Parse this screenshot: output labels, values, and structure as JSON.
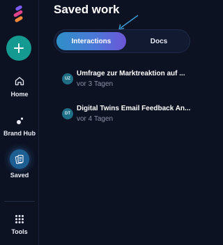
{
  "sidebar": {
    "logo_icon": "app-logo-icon",
    "new_button_icon": "plus-icon",
    "items": [
      {
        "label": "Home",
        "icon": "home-icon"
      },
      {
        "label": "Brand Hub",
        "icon": "brand-hub-icon"
      },
      {
        "label": "Saved",
        "icon": "saved-icon",
        "active": true
      },
      {
        "label": "Tools",
        "icon": "grid-icon"
      }
    ]
  },
  "main": {
    "title": "Saved work",
    "tabs": [
      {
        "label": "Interactions",
        "active": true
      },
      {
        "label": "Docs",
        "active": false
      }
    ],
    "items": [
      {
        "initials": "UZ",
        "title": "Umfrage zur Marktreaktion auf ...",
        "time": "vor 3 Tagen"
      },
      {
        "initials": "DT",
        "title": "Digital Twins Email Feedback An...",
        "time": "vor 4 Tagen"
      }
    ]
  },
  "colors": {
    "background": "#0d1223",
    "accent_teal": "#159a92",
    "tab_gradient_start": "#2f8fc7",
    "tab_gradient_end": "#6d56d8",
    "secondary_text": "#8a91a6",
    "arrow": "#3aa0d8"
  }
}
